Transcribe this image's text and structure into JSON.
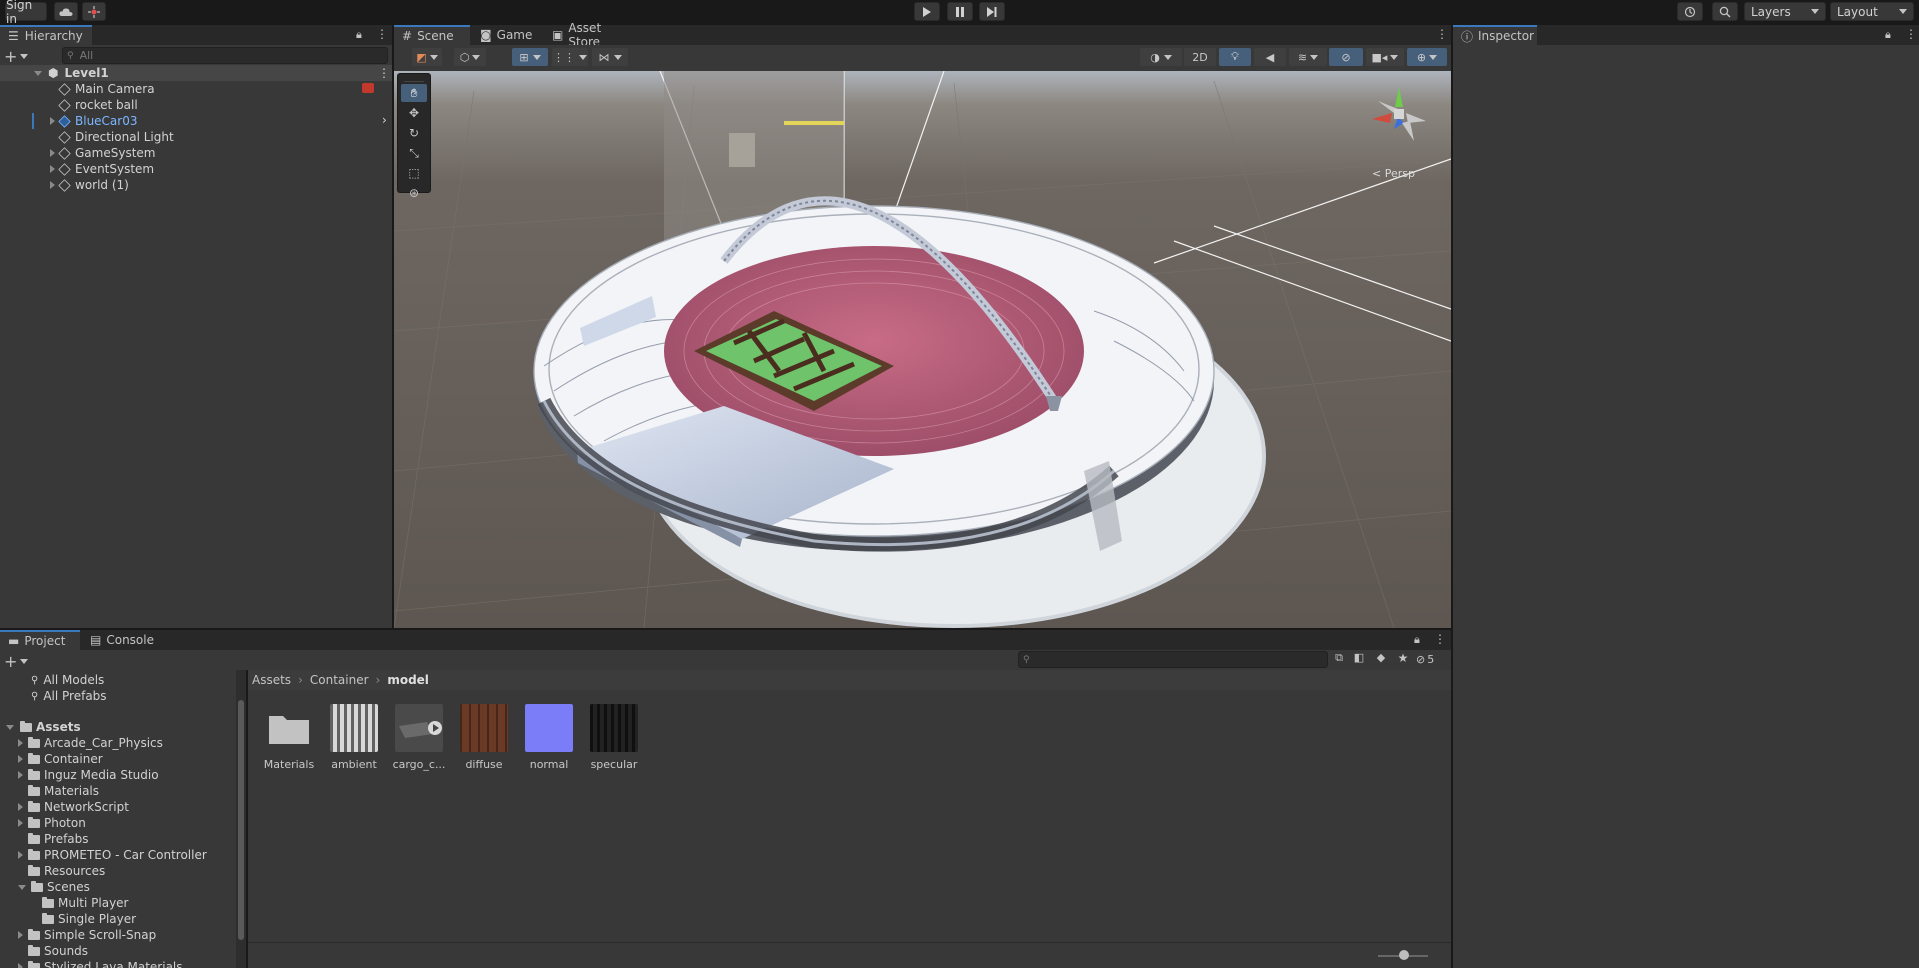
{
  "toolbar": {
    "sign_in": "Sign in",
    "cloud_icon": "cloud-icon",
    "collab_icon": "collab-icon",
    "play_icon": "play-icon",
    "pause_icon": "pause-icon",
    "step_icon": "step-icon",
    "history_icon": "history-icon",
    "search_icon": "search-icon",
    "layers": "Layers",
    "layout": "Layout"
  },
  "hierarchy": {
    "tab": "Hierarchy",
    "search_placeholder": "All",
    "scene": "Level1",
    "items": [
      {
        "label": "Main Camera",
        "selected": false
      },
      {
        "label": "rocket ball",
        "selected": false
      },
      {
        "label": "BlueCar03",
        "selected": false,
        "prefab": true
      },
      {
        "label": "Directional Light",
        "selected": false
      },
      {
        "label": "GameSystem",
        "selected": false
      },
      {
        "label": "EventSystem",
        "selected": false
      },
      {
        "label": "world (1)",
        "selected": false
      }
    ]
  },
  "scene_view": {
    "tabs": [
      "Scene",
      "Game",
      "Asset Store"
    ],
    "active_tab": "Scene",
    "btn_2d": "2D",
    "persp_label": "< Persp",
    "tools": [
      "hand-tool-icon",
      "move-tool-icon",
      "rotate-tool-icon",
      "scale-tool-icon",
      "rect-tool-icon",
      "transform-tool-icon"
    ]
  },
  "inspector": {
    "tab": "Inspector"
  },
  "project": {
    "tabs": [
      "Project",
      "Console"
    ],
    "favorites": [
      "All Models",
      "All Prefabs"
    ],
    "root": "Assets",
    "tree": [
      {
        "label": "Arcade_Car_Physics",
        "indent": 1,
        "fold": "closed"
      },
      {
        "label": "Container",
        "indent": 1,
        "fold": "closed"
      },
      {
        "label": "Inguz Media Studio",
        "indent": 1,
        "fold": "closed"
      },
      {
        "label": "Materials",
        "indent": 1,
        "fold": "none"
      },
      {
        "label": "NetworkScript",
        "indent": 1,
        "fold": "closed"
      },
      {
        "label": "Photon",
        "indent": 1,
        "fold": "closed"
      },
      {
        "label": "Prefabs",
        "indent": 1,
        "fold": "none"
      },
      {
        "label": "PROMETEO - Car Controller",
        "indent": 1,
        "fold": "closed"
      },
      {
        "label": "Resources",
        "indent": 1,
        "fold": "none"
      },
      {
        "label": "Scenes",
        "indent": 1,
        "fold": "open"
      },
      {
        "label": "Multi Player",
        "indent": 2,
        "fold": "none"
      },
      {
        "label": "Single Player",
        "indent": 2,
        "fold": "none"
      },
      {
        "label": "Simple Scroll-Snap",
        "indent": 1,
        "fold": "closed"
      },
      {
        "label": "Sounds",
        "indent": 1,
        "fold": "none"
      },
      {
        "label": "Stylized Lava Materials",
        "indent": 1,
        "fold": "closed"
      }
    ],
    "breadcrumb": [
      "Assets",
      "Container",
      "model"
    ],
    "hidden_count": "5",
    "assets": [
      {
        "label": "Materials",
        "kind": "folder"
      },
      {
        "label": "ambient",
        "kind": "texture"
      },
      {
        "label": "cargo_c...",
        "kind": "model"
      },
      {
        "label": "diffuse",
        "kind": "texture"
      },
      {
        "label": "normal",
        "kind": "texture"
      },
      {
        "label": "specular",
        "kind": "texture"
      }
    ],
    "colors": {
      "ambient": "#d8d8d8",
      "model": "#6a6a6a",
      "diffuse": "#6b3a26",
      "normal": "#7a7cf8",
      "specular": "#222222"
    }
  },
  "colors": {
    "accent": "#3a79bb",
    "prefab_text": "#7cb6ff",
    "panel": "#383838",
    "toolbar": "#191919"
  }
}
